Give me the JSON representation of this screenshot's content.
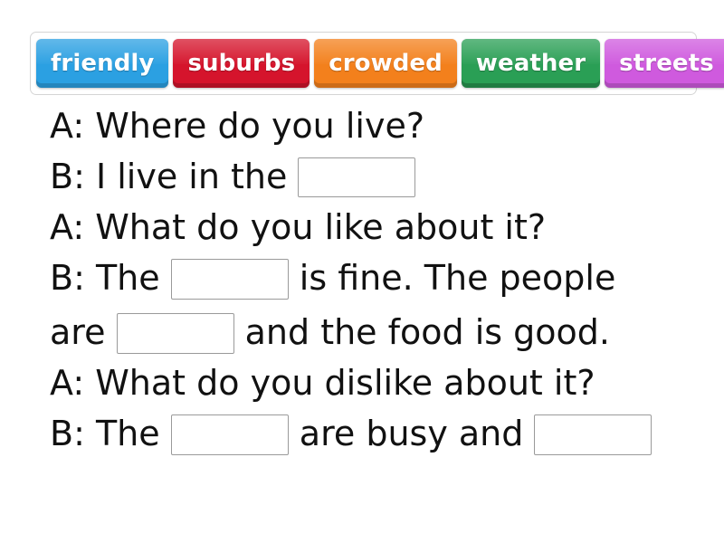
{
  "word_bank": {
    "name": "word-bank",
    "chips": [
      {
        "label": "friendly",
        "color": "#2ba0e2",
        "style": "chip-blue"
      },
      {
        "label": "suburbs",
        "color": "#d5142c",
        "style": "chip-red"
      },
      {
        "label": "crowded",
        "color": "#f3801c",
        "style": "chip-orange"
      },
      {
        "label": "weather",
        "color": "#2a9f55",
        "style": "chip-green"
      },
      {
        "label": "streets",
        "color": "#cf5ade",
        "style": "chip-magenta"
      }
    ]
  },
  "dialogue": {
    "lines": [
      {
        "id": "line-1",
        "speaker": "A:",
        "text": "A: Where do you live?"
      },
      {
        "id": "line-2",
        "before": "B: I live in the ",
        "after": ""
      },
      {
        "id": "line-3",
        "speaker": "A:",
        "text": "A: What do you like about it?"
      },
      {
        "id": "line-4",
        "before": "B: The ",
        "after": " is fine. The people"
      },
      {
        "id": "line-5",
        "before": "are ",
        "after": " and the food is good."
      },
      {
        "id": "line-6",
        "speaker": "A:",
        "text": "A: What do you dislike about it?"
      },
      {
        "id": "line-7",
        "before": "B: The ",
        "middle": " are busy and ",
        "after": ""
      }
    ],
    "blanks": [
      {
        "id": "blank-1",
        "value": "",
        "answer_options": [
          "friendly",
          "suburbs",
          "crowded",
          "weather",
          "streets"
        ]
      },
      {
        "id": "blank-2",
        "value": ""
      },
      {
        "id": "blank-3",
        "value": ""
      },
      {
        "id": "blank-4",
        "value": ""
      },
      {
        "id": "blank-5",
        "value": ""
      }
    ]
  },
  "colors": {
    "page_background": "#ffffff",
    "text": "#111111",
    "wordbank_border": "#d5d5d5",
    "blank_border": "#9a9a9a"
  }
}
